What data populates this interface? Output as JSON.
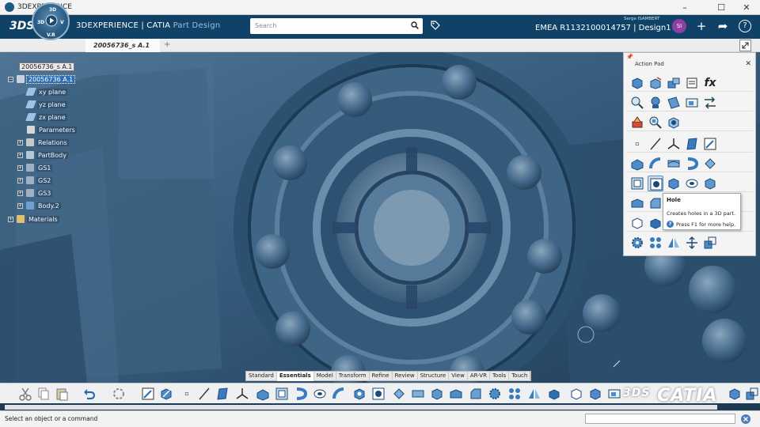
{
  "window": {
    "title": "3DEXPERIENCE",
    "controls": {
      "minimize": "–",
      "maximize": "☐",
      "close": "✕"
    }
  },
  "header": {
    "brand_prefix": "3DEXPERIENCE",
    "brand_sep": " | CATIA ",
    "app_name": "Part Design",
    "search_placeholder": "Search",
    "context": "EMEA R1132100014757 | Design1 ⌄",
    "user_name": "Serge ISAMBERT",
    "avatar_initials": "SI",
    "compass": {
      "top": "3D",
      "right": "V",
      "bottom": "V.R"
    }
  },
  "doc_tab": {
    "label": "20056736_s A.1",
    "add": "+"
  },
  "tree": {
    "items": [
      {
        "label": "20056736_s A.1",
        "kind": "root"
      },
      {
        "label": "20056736 A.1",
        "kind": "selected"
      },
      {
        "label": "xy plane"
      },
      {
        "label": "yz plane"
      },
      {
        "label": "zx plane"
      },
      {
        "label": "Parameters"
      },
      {
        "label": "Relations"
      },
      {
        "label": "PartBody"
      },
      {
        "label": "GS1"
      },
      {
        "label": "GS2"
      },
      {
        "label": "GS3"
      },
      {
        "label": "Body.2"
      },
      {
        "label": "Materials"
      }
    ]
  },
  "action_pad": {
    "title": "Action Pad",
    "close": "✕",
    "fx_label": "fx"
  },
  "tooltip": {
    "title": "Hole",
    "description": "Creates holes in a 3D part.",
    "help": "Press F1 for more help.",
    "help_icon": "?"
  },
  "section_tabs": [
    "Standard",
    "Essentials",
    "Model",
    "Transform",
    "Refine",
    "Review",
    "Structure",
    "View",
    "AR-VR",
    "Tools",
    "Touch"
  ],
  "active_section": "Essentials",
  "watermark": {
    "logo": "3DS",
    "text": "CATIA"
  },
  "status": {
    "message": "Select an object or a command"
  },
  "colors": {
    "header_bg": "#0f4266",
    "accent": "#2f6fb3",
    "avatar": "#8e3fa5",
    "part_blue": "#3d6384"
  }
}
